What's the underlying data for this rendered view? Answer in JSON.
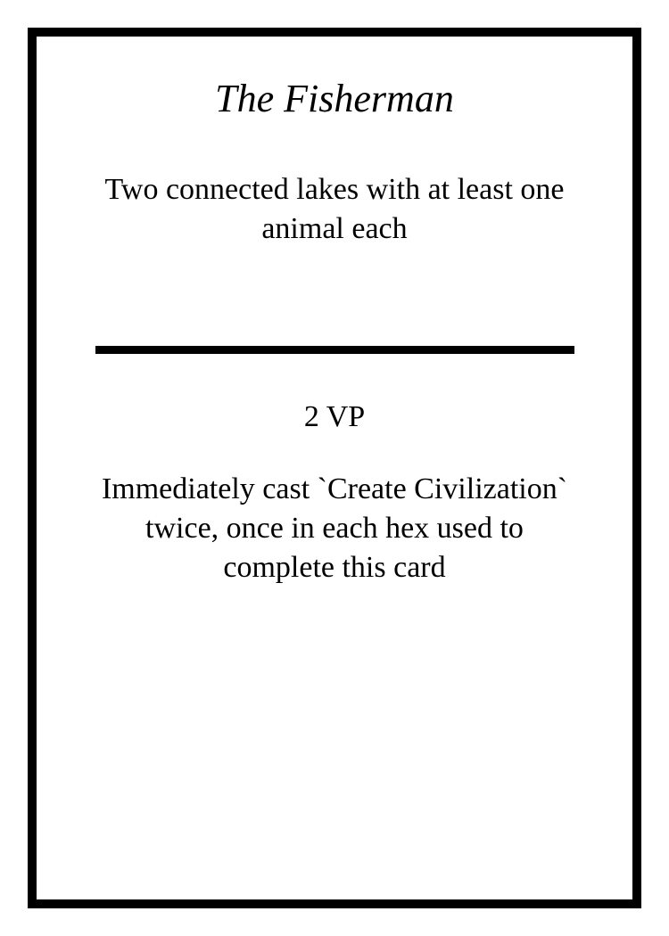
{
  "card": {
    "title": "The Fisherman",
    "requirement": "Two connected lakes with at least one animal each",
    "points": "2 VP",
    "effect": "Immediately cast `Create Civilization` twice, once in each hex used to complete this card"
  }
}
